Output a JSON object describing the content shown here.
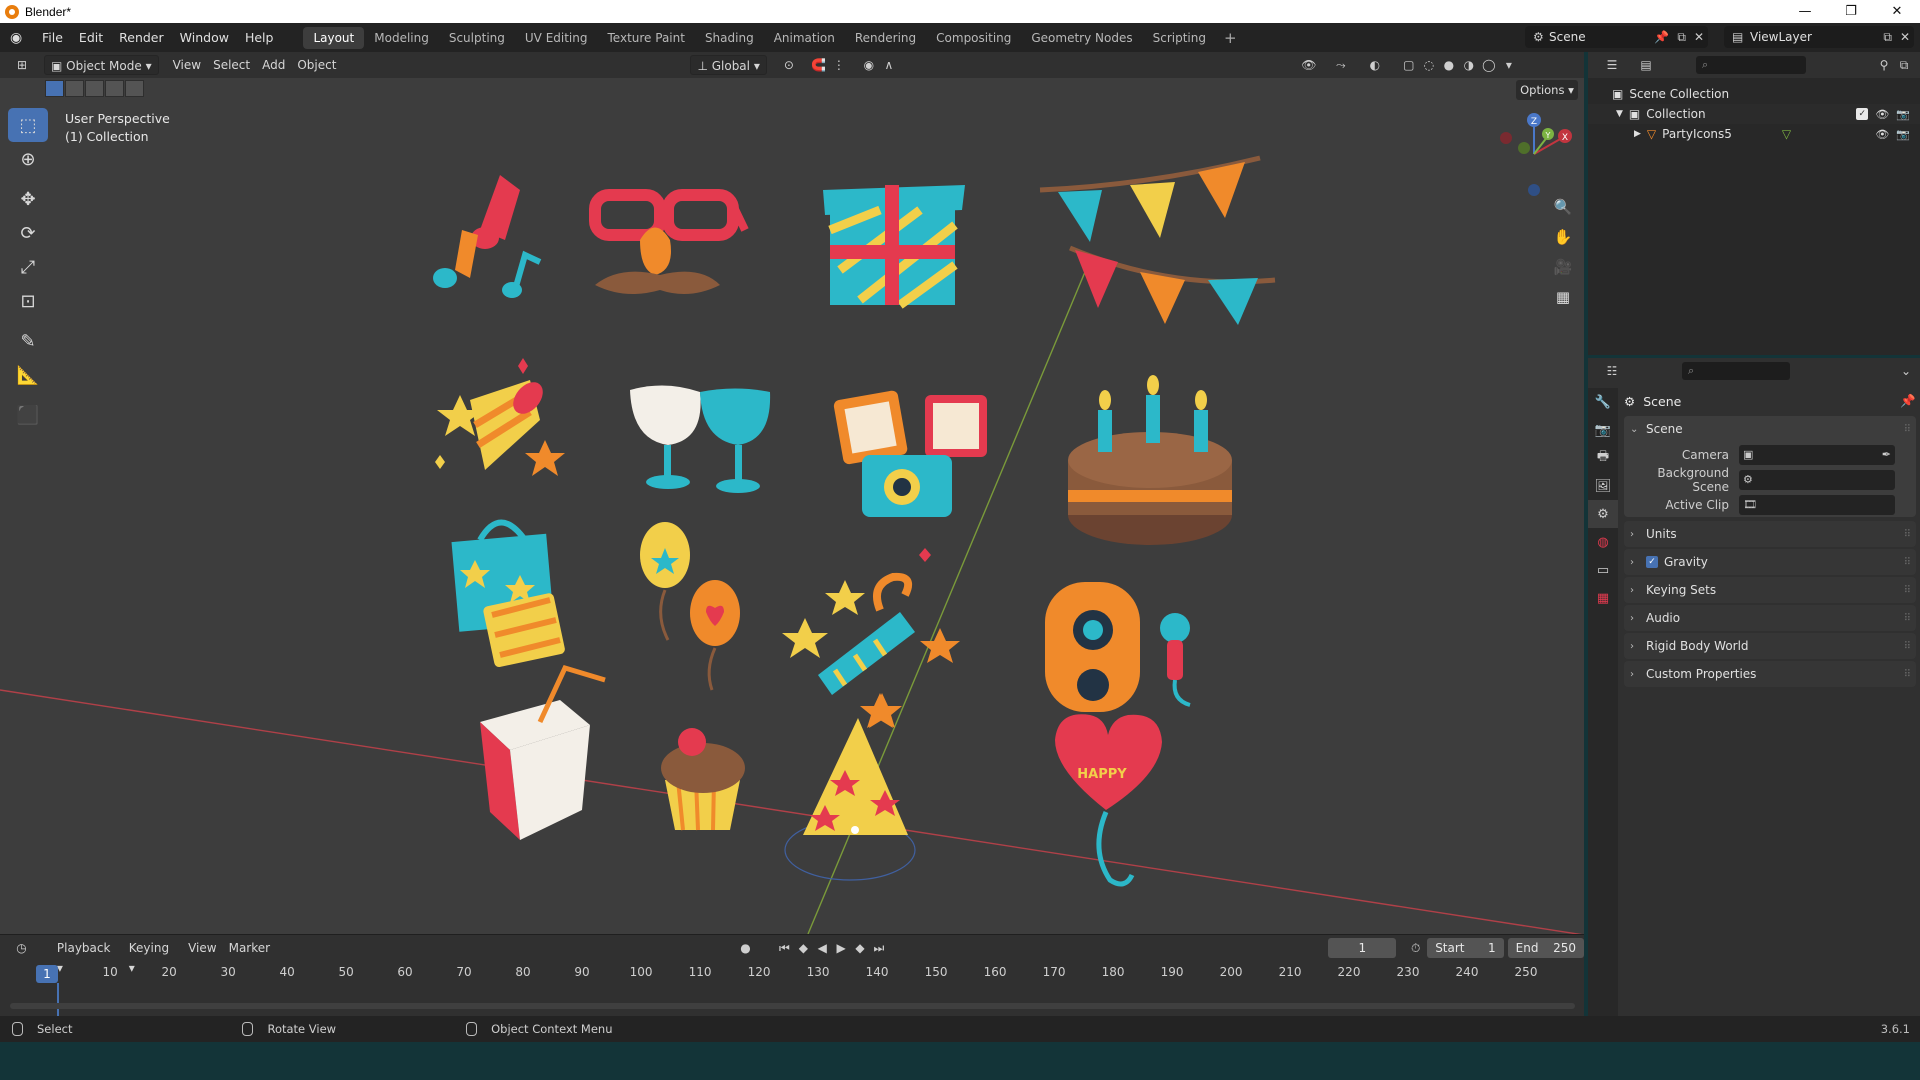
{
  "window": {
    "title": "Blender*",
    "controls": [
      "minimize",
      "maximize",
      "close"
    ]
  },
  "menubar": {
    "menus": [
      "File",
      "Edit",
      "Render",
      "Window",
      "Help"
    ],
    "workspaces": [
      "Layout",
      "Modeling",
      "Sculpting",
      "UV Editing",
      "Texture Paint",
      "Shading",
      "Animation",
      "Rendering",
      "Compositing",
      "Geometry Nodes",
      "Scripting"
    ],
    "active_workspace": "Layout",
    "scene_name": "Scene",
    "view_layer_name": "ViewLayer"
  },
  "viewport": {
    "mode": "Object Mode",
    "menus": [
      "View",
      "Select",
      "Add",
      "Object"
    ],
    "transform_orientation": "Global",
    "options_label": "Options",
    "overlay_info": {
      "line1": "User Perspective",
      "line2": "(1) Collection"
    },
    "gizmo_axes": [
      "X",
      "Y",
      "Z"
    ],
    "tools": [
      "select-box",
      "cursor",
      "move",
      "rotate",
      "scale",
      "transform",
      "annotate",
      "measure",
      "add-cube"
    ],
    "active_tool": "select-box",
    "heart_balloon_text": "HAPPY"
  },
  "outliner": {
    "rows": [
      {
        "label": "Scene Collection",
        "icon": "collection-icon"
      },
      {
        "label": "Collection",
        "icon": "collection-icon"
      },
      {
        "label": "PartyIcons5",
        "icon": "mesh-icon"
      }
    ]
  },
  "properties": {
    "context_title": "Scene",
    "scene_panel": {
      "title": "Scene",
      "fields": [
        {
          "label": "Camera",
          "value": ""
        },
        {
          "label": "Background Scene",
          "value": ""
        },
        {
          "label": "Active Clip",
          "value": ""
        }
      ]
    },
    "collapsed_panels": [
      {
        "label": "Units",
        "checkbox": false
      },
      {
        "label": "Gravity",
        "checkbox": true
      },
      {
        "label": "Keying Sets",
        "checkbox": false
      },
      {
        "label": "Audio",
        "checkbox": false
      },
      {
        "label": "Rigid Body World",
        "checkbox": false
      },
      {
        "label": "Custom Properties",
        "checkbox": false
      }
    ]
  },
  "timeline": {
    "menus": [
      "Playback",
      "Keying",
      "View",
      "Marker"
    ],
    "current_frame": "1",
    "start_label": "Start",
    "start_value": "1",
    "end_label": "End",
    "end_value": "250",
    "ruler_labels": [
      "10",
      "20",
      "30",
      "40",
      "50",
      "60",
      "70",
      "80",
      "90",
      "100",
      "110",
      "120",
      "130",
      "140",
      "150",
      "160",
      "170",
      "180",
      "190",
      "200",
      "210",
      "220",
      "230",
      "240",
      "250"
    ],
    "playhead_label": "1"
  },
  "statusbar": {
    "items": [
      "Select",
      "Rotate View",
      "Object Context Menu"
    ],
    "version": "3.6.1"
  },
  "colors": {
    "accent": "#4772b3",
    "viewport_bg": "#3d3d3d",
    "x_axis": "#c2353f",
    "y_axis": "#7cb342",
    "teal": "#2cb8c9",
    "orange": "#f08a2b",
    "red": "#e43a4f",
    "yellow": "#f2cf4a"
  }
}
